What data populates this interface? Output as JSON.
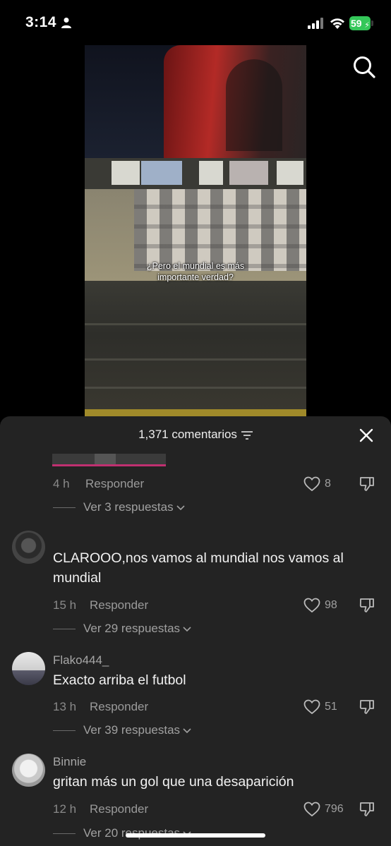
{
  "status": {
    "time": "3:14",
    "battery": "59"
  },
  "video": {
    "caption_line1": "¿Pero el mundial es más",
    "caption_line2": "importante verdad?"
  },
  "sheet": {
    "comment_count": "1,371 comentarios"
  },
  "comments": [
    {
      "ago": "4 h",
      "reply_label": "Responder",
      "likes": "8",
      "replies": "Ver 3 respuestas"
    },
    {
      "text": "CLAROOO,nos vamos al mundial nos vamos al mundial",
      "ago": "15 h",
      "reply_label": "Responder",
      "likes": "98",
      "replies": "Ver 29 respuestas"
    },
    {
      "username": "Flako444_",
      "text": "Exacto arriba el futbol",
      "ago": "13 h",
      "reply_label": "Responder",
      "likes": "51",
      "replies": "Ver 39 respuestas"
    },
    {
      "username": "Binnie",
      "text": "gritan más un gol que una desaparición",
      "ago": "12 h",
      "reply_label": "Responder",
      "likes": "796",
      "replies": "Ver 20 respuestas"
    }
  ],
  "colors": {
    "sheet_bg": "#232323",
    "battery": "#34c759",
    "muted_text": "#8a8a8a"
  },
  "icons": [
    "person-icon",
    "signal-icon",
    "wifi-icon",
    "search-icon",
    "filter-icon",
    "close-icon",
    "heart-icon",
    "dislike-icon",
    "chevron-down-icon"
  ]
}
